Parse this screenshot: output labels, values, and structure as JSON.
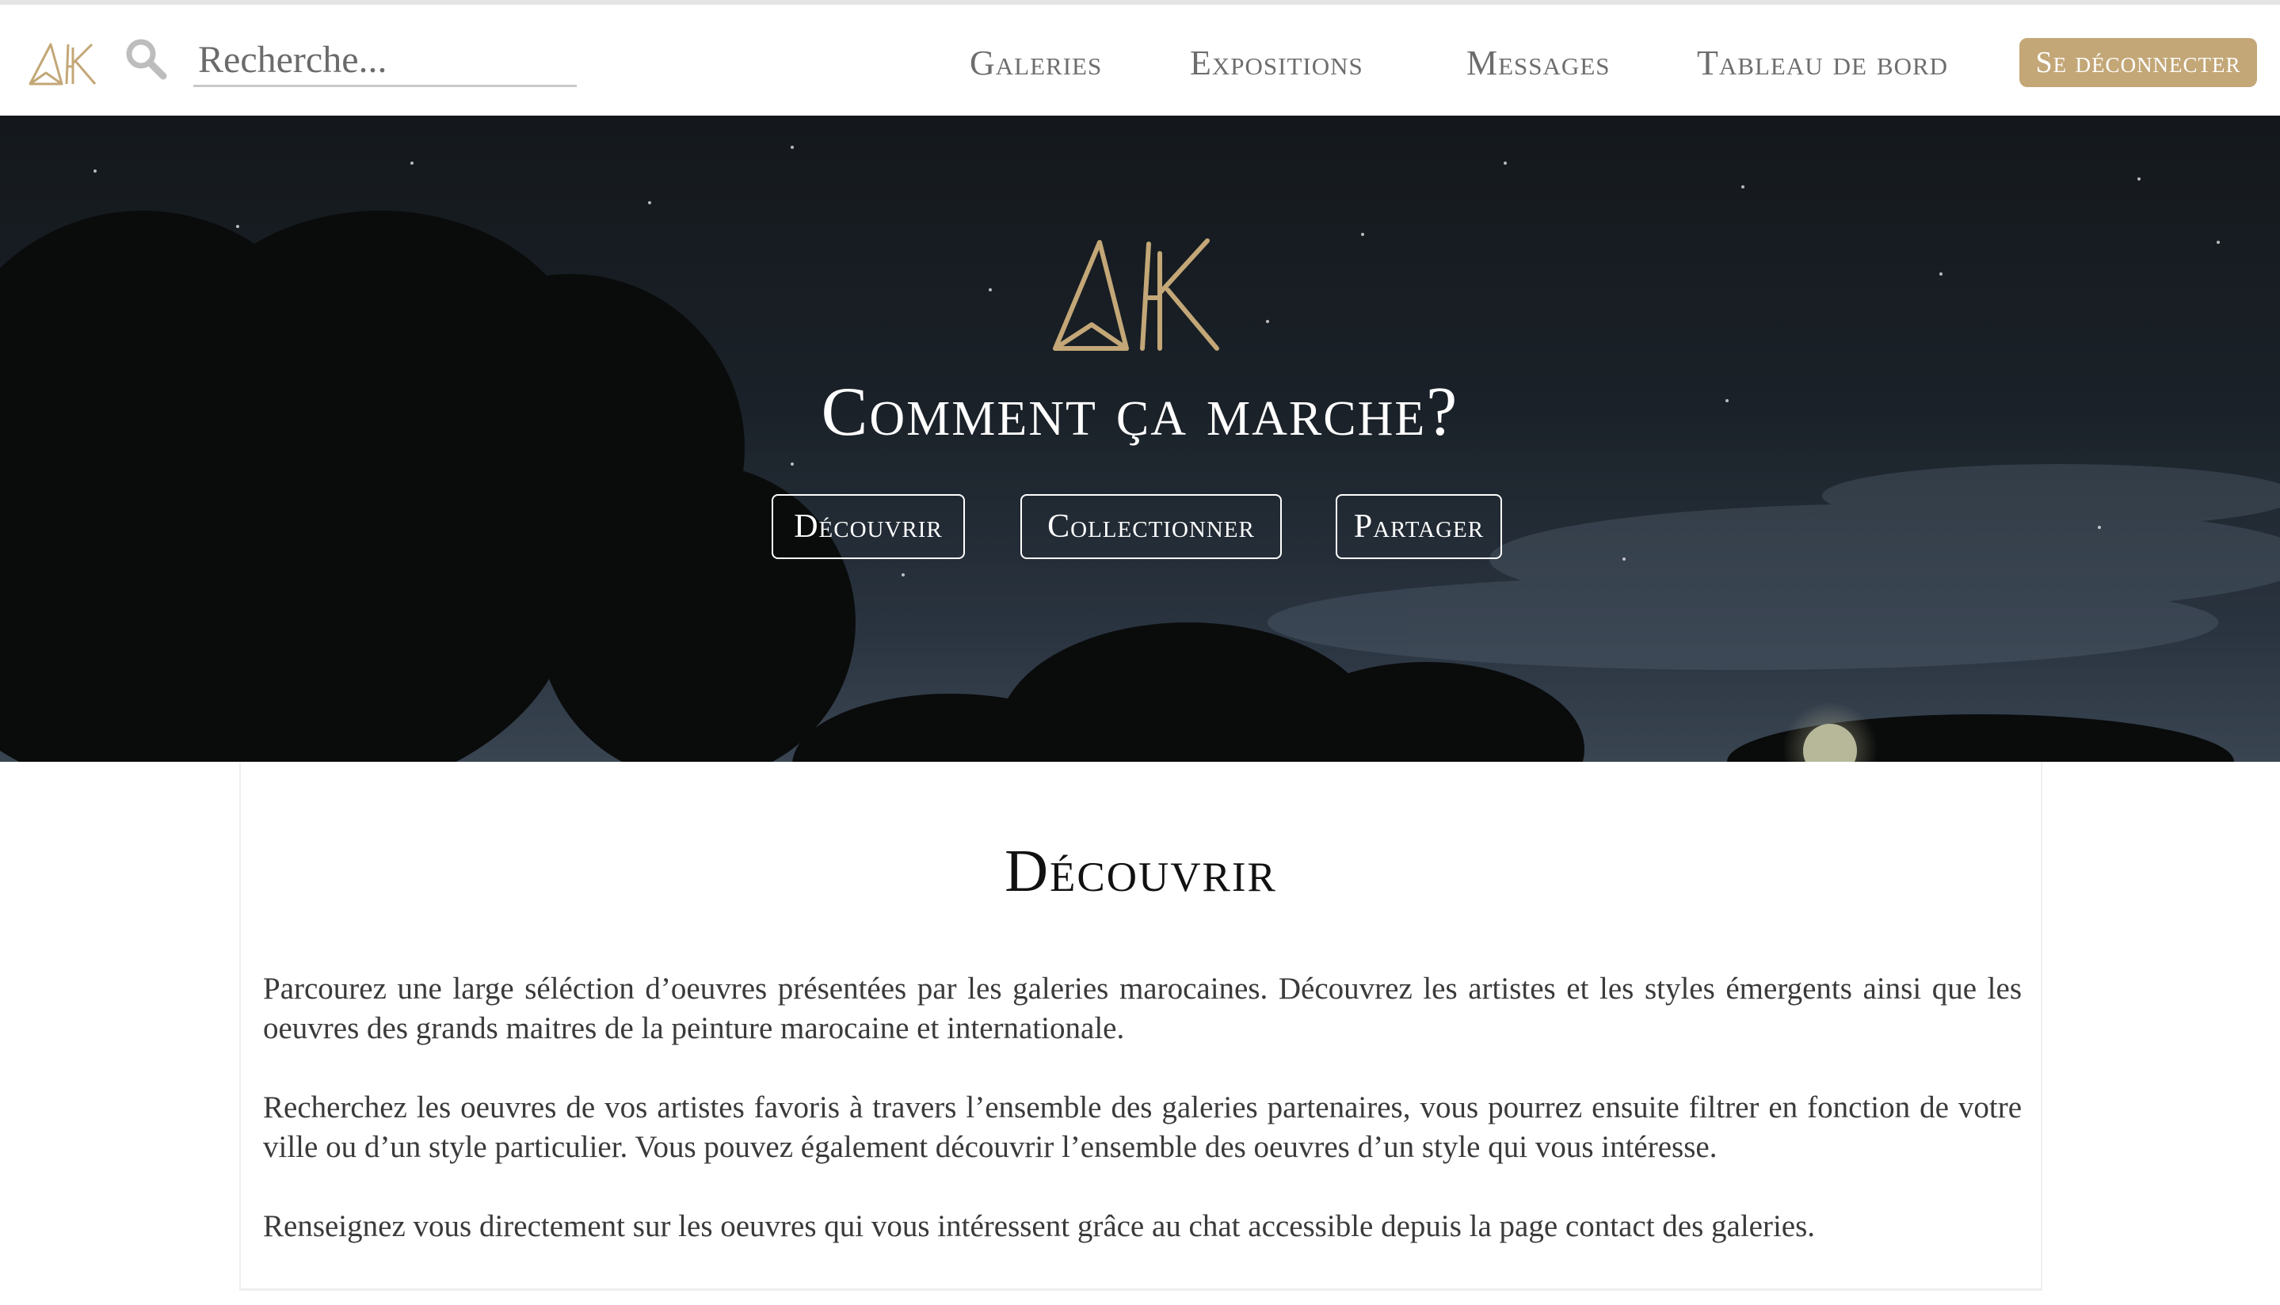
{
  "nav": {
    "logo_text": "AK",
    "search_placeholder": "Recherche...",
    "links": [
      "Galeries",
      "Expositions",
      "Messages",
      "Tableau de bord"
    ],
    "logout_label": "Se déconnecter",
    "accent_color": "#c3a777"
  },
  "hero": {
    "logo_text": "AK",
    "title": "Comment ça marche?",
    "buttons": [
      "Découvrir",
      "Collectionner",
      "Partager"
    ]
  },
  "section": {
    "title": "Découvrir",
    "paragraphs": [
      "Parcourez une large séléction d’oeuvres présentées par les galeries marocaines. Découvrez les artistes et les styles émergents ainsi que les oeuvres des grands maitres de la peinture marocaine et internationale.",
      "Recherchez les oeuvres de vos artistes favoris à travers l’ensemble des galeries partenaires, vous pourrez ensuite filtrer en fonction de votre ville ou d’un style particulier. Vous pouvez également découvrir l’ensemble des oeuvres d’un style qui vous intéresse.",
      "Renseignez vous directement sur les oeuvres qui vous intéressent grâce au chat accessible depuis la page contact des galeries."
    ]
  }
}
